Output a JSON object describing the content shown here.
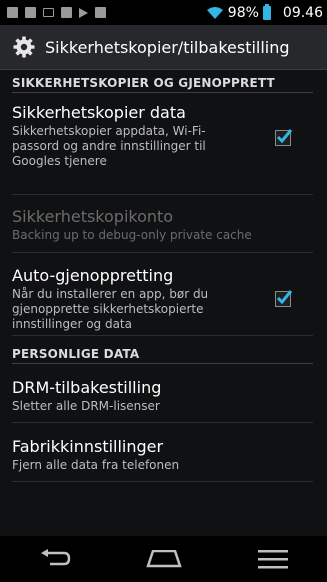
{
  "status_bar": {
    "battery_percent": "98%",
    "time": "09.46",
    "icons": [
      "sim-icon",
      "image-icon",
      "mail-icon",
      "calendar-icon",
      "play-store-icon",
      "gallery-icon"
    ]
  },
  "action_bar": {
    "title": "Sikkerhetskopier/tilbakestilling"
  },
  "sections": [
    {
      "header": "SIKKERHETSKOPIER OG GJENOPPRETT",
      "items": [
        {
          "title": "Sikkerhetskopier data",
          "summary": "Sikkerhetskopier appdata, Wi-Fi-passord og andre innstillinger til Googles tjenere",
          "checked": true,
          "enabled": true
        },
        {
          "title": "Sikkerhetskopikonto",
          "summary": "Backing up to debug-only private cache",
          "enabled": false
        },
        {
          "title": "Auto-gjenoppretting",
          "summary": "Når du installerer en app, bør du gjenopprette sikkerhetskopierte innstillinger og data",
          "checked": true,
          "enabled": true
        }
      ]
    },
    {
      "header": "PERSONLIGE DATA",
      "items": [
        {
          "title": "DRM-tilbakestilling",
          "summary": "Sletter alle DRM-lisenser",
          "enabled": true
        },
        {
          "title": "Fabrikkinnstillinger",
          "summary": "Fjern alle data fra telefonen",
          "enabled": true
        }
      ]
    }
  ],
  "colors": {
    "accent": "#33b5e5",
    "background": "#101113",
    "action_bar": "#26282b"
  }
}
